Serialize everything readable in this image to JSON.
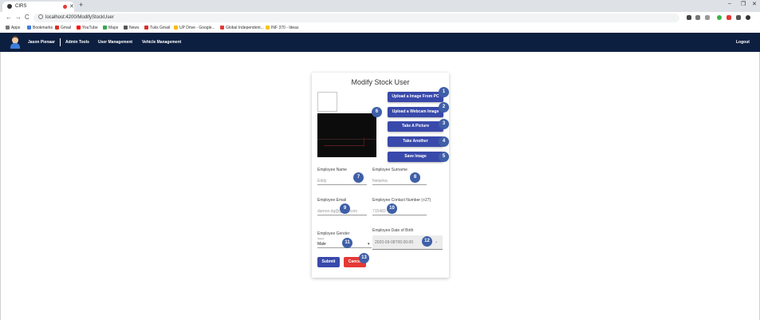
{
  "browser": {
    "tab_title": "CIRS",
    "new_tab": "+",
    "window_controls": {
      "minimize": "–",
      "restore": "❐",
      "close": "✕"
    },
    "back": "←",
    "forward": "→",
    "reload": "C",
    "url": "localhost:4200/ModifyStockUser",
    "bookmarks": [
      "Apps",
      "Bookmarks",
      "Gmail",
      "YouTube",
      "Maps",
      "News",
      "Tuks Gmail",
      "UP Drive - Google...",
      "Global Independent...",
      "INF 370 - Ideas"
    ]
  },
  "app_nav": {
    "user_name": "Jason Pienaar",
    "items": [
      "Admin Tools",
      "User Management",
      "Vehicle Management"
    ],
    "logout": "Logout"
  },
  "form": {
    "title": "Modify Stock User",
    "buttons": {
      "upload_pc": "Upload a Image From PC",
      "upload_webcam": "Upload a Webcam Image",
      "take_picture": "Take A Picture",
      "take_another": "Take Another",
      "save_image": "Save Image"
    },
    "name_label": "Employee Name",
    "name_value": "Eddy",
    "surname_label": "Employee Surname",
    "surname_value": "Netanka",
    "email_label": "Employee Email",
    "email_value": "damon.dg@gmail.com",
    "contact_label": "Employee Contact Number (+27)",
    "contact_value": "715483",
    "gender_label": "Employee Gender",
    "gender_small": "Select",
    "gender_value": "Male",
    "dob_label": "Employee Date of Birth",
    "dob_value": "2020-09-08T00:00:00",
    "submit": "Submit",
    "cancel": "Cancel"
  },
  "badges": [
    "1",
    "2",
    "3",
    "4",
    "5",
    "6",
    "7",
    "8",
    "9",
    "10",
    "11",
    "12",
    "13"
  ],
  "colors": {
    "nav_bg": "#0d1f40",
    "primary": "#3949ab",
    "danger": "#e53935",
    "badge": "#3f5fa8"
  }
}
